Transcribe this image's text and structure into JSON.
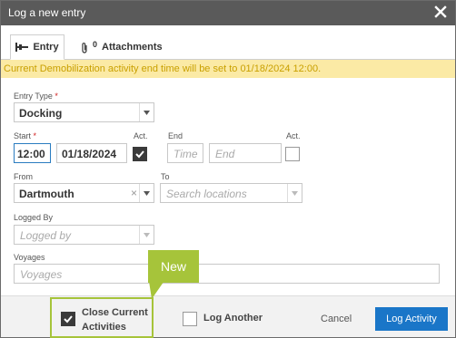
{
  "dialog": {
    "title": "Log a new entry"
  },
  "tabs": {
    "entry_label": "Entry",
    "attachments_count": "0",
    "attachments_label": "Attachments"
  },
  "banner": {
    "text": "Current Demobilization activity end time will be set to 01/18/2024 12:00."
  },
  "form": {
    "entry_type": {
      "label": "Entry Type",
      "required": "*",
      "value": "Docking"
    },
    "start": {
      "label": "Start",
      "required": "*",
      "time": "12:00",
      "date": "01/18/2024",
      "act_label": "Act.",
      "act_checked": true
    },
    "end": {
      "label": "End",
      "time_placeholder": "Time",
      "date_placeholder": "End",
      "act_label": "Act.",
      "act_checked": false
    },
    "from": {
      "label": "From",
      "value": "Dartmouth",
      "clear": "×"
    },
    "to": {
      "label": "To",
      "placeholder": "Search locations"
    },
    "logged_by": {
      "label": "Logged By",
      "placeholder": "Logged by"
    },
    "voyages": {
      "label": "Voyages",
      "placeholder": "Voyages"
    }
  },
  "footer": {
    "close_activities_line1": "Close Current",
    "close_activities_line2": "Activities",
    "close_activities_checked": true,
    "log_another_label": "Log Another",
    "log_another_checked": false,
    "cancel_label": "Cancel",
    "submit_label": "Log Activity"
  },
  "callout": {
    "text": "New",
    "color": "#a6c43a"
  },
  "colors": {
    "titlebar": "#5a5a5a",
    "banner_bg": "#fbeaa5",
    "banner_text": "#c9a000",
    "primary": "#1a76c8",
    "required": "#d02020"
  }
}
